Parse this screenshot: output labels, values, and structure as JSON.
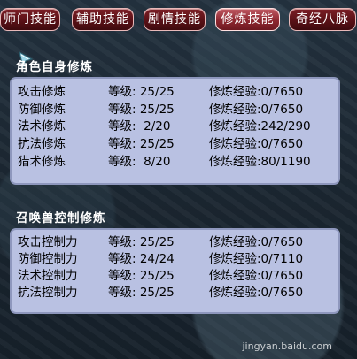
{
  "tabs": [
    {
      "label": "师门技能",
      "active": false
    },
    {
      "label": "辅助技能",
      "active": false
    },
    {
      "label": "剧情技能",
      "active": false
    },
    {
      "label": "修炼技能",
      "active": true
    },
    {
      "label": "奇经八脉",
      "active": false
    }
  ],
  "self_section": {
    "title": "角色自身修炼",
    "rows": [
      {
        "name": "攻击修炼",
        "level": "等级: 25/25",
        "exp": "修炼经验:0/7650"
      },
      {
        "name": "防御修炼",
        "level": "等级: 25/25",
        "exp": "修炼经验:0/7650"
      },
      {
        "name": "法术修炼",
        "level": "等级:  2/20",
        "exp": "修炼经验:242/290"
      },
      {
        "name": "抗法修炼",
        "level": "等级: 25/25",
        "exp": "修炼经验:0/7650"
      },
      {
        "name": "猎术修炼",
        "level": "等级:  8/20",
        "exp": "修炼经验:80/1190"
      }
    ]
  },
  "pet_section": {
    "title": "召唤兽控制修炼",
    "rows": [
      {
        "name": "攻击控制力",
        "level": "等级: 25/25",
        "exp": "修炼经验:0/7650"
      },
      {
        "name": "防御控制力",
        "level": "等级: 24/24",
        "exp": "修炼经验:0/7110"
      },
      {
        "name": "法术控制力",
        "level": "等级: 25/25",
        "exp": "修炼经验:0/7650"
      },
      {
        "name": "抗法控制力",
        "level": "等级: 25/25",
        "exp": "修炼经验:0/7650"
      }
    ]
  },
  "watermark": "jingyan.baidu.com",
  "colors": {
    "tab_active": "#8e2730",
    "tab": "#5d1218",
    "panel": "#b9c1e2"
  }
}
